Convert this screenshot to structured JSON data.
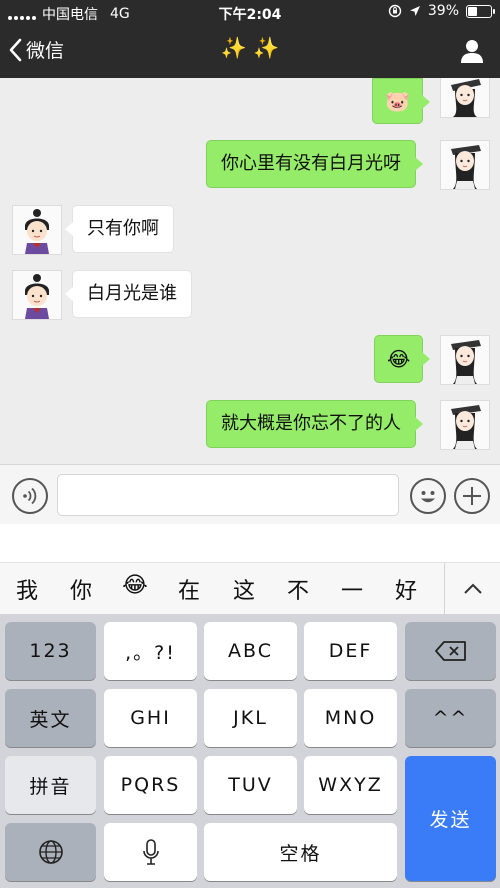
{
  "status_bar": {
    "carrier": "中国电信",
    "network": "4G",
    "time": "下午2:04",
    "battery": "39%"
  },
  "nav": {
    "back_label": "微信",
    "title": "✨ ✨"
  },
  "messages": [
    {
      "from": "me",
      "type": "emoji",
      "text": "🐷"
    },
    {
      "from": "me",
      "type": "text",
      "text": "你心里有没有白月光呀"
    },
    {
      "from": "them",
      "type": "text",
      "text": "只有你啊"
    },
    {
      "from": "them",
      "type": "text",
      "text": "白月光是谁"
    },
    {
      "from": "me",
      "type": "emoji",
      "text": "😂"
    },
    {
      "from": "me",
      "type": "text",
      "text": "就大概是你忘不了的人"
    }
  ],
  "input": {
    "value": ""
  },
  "candidates": [
    "我",
    "你",
    "😂",
    "在",
    "这",
    "不",
    "一",
    "好"
  ],
  "keyboard": {
    "k123": "123",
    "punct": ",。?!",
    "abc": "ABC",
    "def": "DEF",
    "english": "英文",
    "ghi": "GHI",
    "jkl": "JKL",
    "mno": "MNO",
    "face": "^^",
    "pinyin": "拼音",
    "pqrs": "PQRS",
    "tuv": "TUV",
    "wxyz": "WXYZ",
    "send": "发送",
    "space": "空格"
  },
  "colors": {
    "my_bubble": "#95ec69",
    "their_bubble": "#ffffff",
    "send_key": "#3a7bf7",
    "title": "#f5c542"
  }
}
